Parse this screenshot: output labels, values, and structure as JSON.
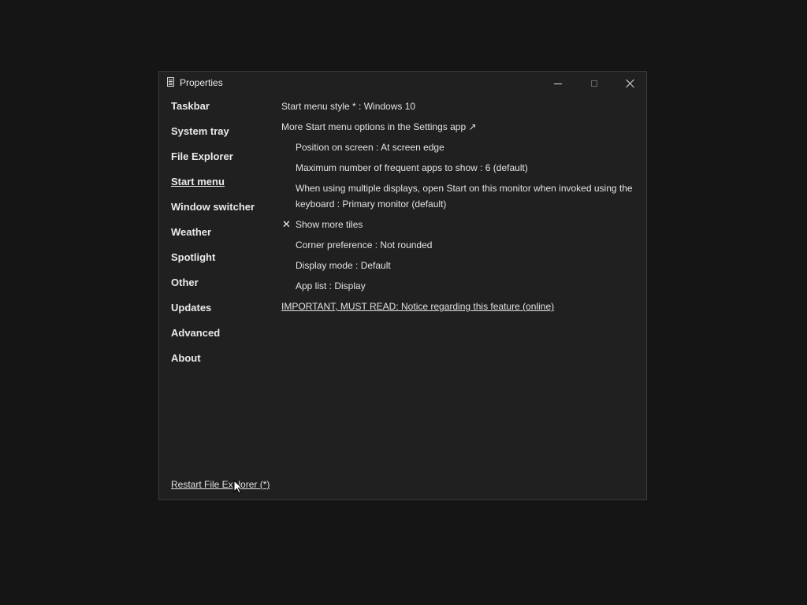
{
  "window": {
    "title": "Properties"
  },
  "sidebar": {
    "items": [
      {
        "label": "Taskbar"
      },
      {
        "label": "System tray"
      },
      {
        "label": "File Explorer"
      },
      {
        "label": "Start menu",
        "active": true
      },
      {
        "label": "Window switcher"
      },
      {
        "label": "Weather"
      },
      {
        "label": "Spotlight"
      },
      {
        "label": "Other"
      },
      {
        "label": "Updates"
      },
      {
        "label": "Advanced"
      },
      {
        "label": "About"
      }
    ],
    "restart_label": "Restart File Explorer (*)"
  },
  "content": {
    "start_menu_style": "Start menu style * : Windows 10",
    "more_options": "More Start menu options in the Settings app ↗",
    "position_on_screen": "Position on screen : At screen edge",
    "max_frequent_apps": "Maximum number of frequent apps to show : 6 (default)",
    "multiple_displays": "When using multiple displays, open Start on this monitor when invoked using the keyboard : Primary monitor (default)",
    "show_more_tiles": "Show more tiles",
    "show_more_tiles_check": "✕",
    "corner_preference": "Corner preference : Not rounded",
    "display_mode": "Display mode : Default",
    "app_list": "App list : Display",
    "important_notice": "IMPORTANT, MUST READ: Notice regarding this feature (online)"
  },
  "colors": {
    "desktop_bg": "#151515",
    "window_bg": "#202020",
    "text": "#e6e6e6"
  },
  "icons": {
    "app": "properties-icon",
    "minimize": "minimize-icon",
    "maximize": "maximize-icon",
    "close": "close-icon",
    "cursor": "mouse-cursor-icon"
  }
}
